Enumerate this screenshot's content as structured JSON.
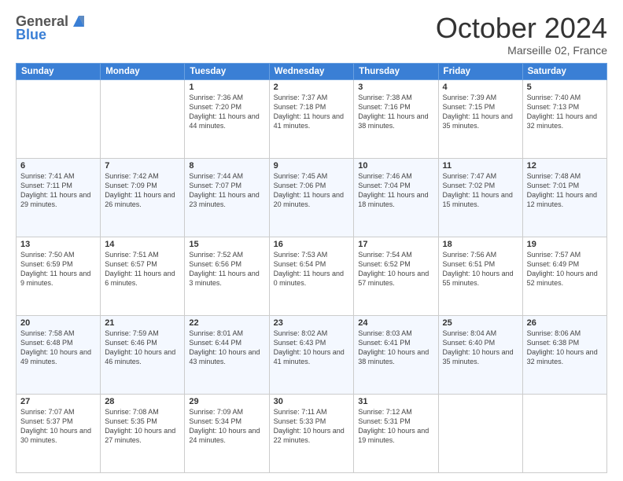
{
  "header": {
    "logo_line1": "General",
    "logo_line2": "Blue",
    "month": "October 2024",
    "location": "Marseille 02, France"
  },
  "days_of_week": [
    "Sunday",
    "Monday",
    "Tuesday",
    "Wednesday",
    "Thursday",
    "Friday",
    "Saturday"
  ],
  "weeks": [
    [
      {
        "day": "",
        "sunrise": "",
        "sunset": "",
        "daylight": ""
      },
      {
        "day": "",
        "sunrise": "",
        "sunset": "",
        "daylight": ""
      },
      {
        "day": "1",
        "sunrise": "Sunrise: 7:36 AM",
        "sunset": "Sunset: 7:20 PM",
        "daylight": "Daylight: 11 hours and 44 minutes."
      },
      {
        "day": "2",
        "sunrise": "Sunrise: 7:37 AM",
        "sunset": "Sunset: 7:18 PM",
        "daylight": "Daylight: 11 hours and 41 minutes."
      },
      {
        "day": "3",
        "sunrise": "Sunrise: 7:38 AM",
        "sunset": "Sunset: 7:16 PM",
        "daylight": "Daylight: 11 hours and 38 minutes."
      },
      {
        "day": "4",
        "sunrise": "Sunrise: 7:39 AM",
        "sunset": "Sunset: 7:15 PM",
        "daylight": "Daylight: 11 hours and 35 minutes."
      },
      {
        "day": "5",
        "sunrise": "Sunrise: 7:40 AM",
        "sunset": "Sunset: 7:13 PM",
        "daylight": "Daylight: 11 hours and 32 minutes."
      }
    ],
    [
      {
        "day": "6",
        "sunrise": "Sunrise: 7:41 AM",
        "sunset": "Sunset: 7:11 PM",
        "daylight": "Daylight: 11 hours and 29 minutes."
      },
      {
        "day": "7",
        "sunrise": "Sunrise: 7:42 AM",
        "sunset": "Sunset: 7:09 PM",
        "daylight": "Daylight: 11 hours and 26 minutes."
      },
      {
        "day": "8",
        "sunrise": "Sunrise: 7:44 AM",
        "sunset": "Sunset: 7:07 PM",
        "daylight": "Daylight: 11 hours and 23 minutes."
      },
      {
        "day": "9",
        "sunrise": "Sunrise: 7:45 AM",
        "sunset": "Sunset: 7:06 PM",
        "daylight": "Daylight: 11 hours and 20 minutes."
      },
      {
        "day": "10",
        "sunrise": "Sunrise: 7:46 AM",
        "sunset": "Sunset: 7:04 PM",
        "daylight": "Daylight: 11 hours and 18 minutes."
      },
      {
        "day": "11",
        "sunrise": "Sunrise: 7:47 AM",
        "sunset": "Sunset: 7:02 PM",
        "daylight": "Daylight: 11 hours and 15 minutes."
      },
      {
        "day": "12",
        "sunrise": "Sunrise: 7:48 AM",
        "sunset": "Sunset: 7:01 PM",
        "daylight": "Daylight: 11 hours and 12 minutes."
      }
    ],
    [
      {
        "day": "13",
        "sunrise": "Sunrise: 7:50 AM",
        "sunset": "Sunset: 6:59 PM",
        "daylight": "Daylight: 11 hours and 9 minutes."
      },
      {
        "day": "14",
        "sunrise": "Sunrise: 7:51 AM",
        "sunset": "Sunset: 6:57 PM",
        "daylight": "Daylight: 11 hours and 6 minutes."
      },
      {
        "day": "15",
        "sunrise": "Sunrise: 7:52 AM",
        "sunset": "Sunset: 6:56 PM",
        "daylight": "Daylight: 11 hours and 3 minutes."
      },
      {
        "day": "16",
        "sunrise": "Sunrise: 7:53 AM",
        "sunset": "Sunset: 6:54 PM",
        "daylight": "Daylight: 11 hours and 0 minutes."
      },
      {
        "day": "17",
        "sunrise": "Sunrise: 7:54 AM",
        "sunset": "Sunset: 6:52 PM",
        "daylight": "Daylight: 10 hours and 57 minutes."
      },
      {
        "day": "18",
        "sunrise": "Sunrise: 7:56 AM",
        "sunset": "Sunset: 6:51 PM",
        "daylight": "Daylight: 10 hours and 55 minutes."
      },
      {
        "day": "19",
        "sunrise": "Sunrise: 7:57 AM",
        "sunset": "Sunset: 6:49 PM",
        "daylight": "Daylight: 10 hours and 52 minutes."
      }
    ],
    [
      {
        "day": "20",
        "sunrise": "Sunrise: 7:58 AM",
        "sunset": "Sunset: 6:48 PM",
        "daylight": "Daylight: 10 hours and 49 minutes."
      },
      {
        "day": "21",
        "sunrise": "Sunrise: 7:59 AM",
        "sunset": "Sunset: 6:46 PM",
        "daylight": "Daylight: 10 hours and 46 minutes."
      },
      {
        "day": "22",
        "sunrise": "Sunrise: 8:01 AM",
        "sunset": "Sunset: 6:44 PM",
        "daylight": "Daylight: 10 hours and 43 minutes."
      },
      {
        "day": "23",
        "sunrise": "Sunrise: 8:02 AM",
        "sunset": "Sunset: 6:43 PM",
        "daylight": "Daylight: 10 hours and 41 minutes."
      },
      {
        "day": "24",
        "sunrise": "Sunrise: 8:03 AM",
        "sunset": "Sunset: 6:41 PM",
        "daylight": "Daylight: 10 hours and 38 minutes."
      },
      {
        "day": "25",
        "sunrise": "Sunrise: 8:04 AM",
        "sunset": "Sunset: 6:40 PM",
        "daylight": "Daylight: 10 hours and 35 minutes."
      },
      {
        "day": "26",
        "sunrise": "Sunrise: 8:06 AM",
        "sunset": "Sunset: 6:38 PM",
        "daylight": "Daylight: 10 hours and 32 minutes."
      }
    ],
    [
      {
        "day": "27",
        "sunrise": "Sunrise: 7:07 AM",
        "sunset": "Sunset: 5:37 PM",
        "daylight": "Daylight: 10 hours and 30 minutes."
      },
      {
        "day": "28",
        "sunrise": "Sunrise: 7:08 AM",
        "sunset": "Sunset: 5:35 PM",
        "daylight": "Daylight: 10 hours and 27 minutes."
      },
      {
        "day": "29",
        "sunrise": "Sunrise: 7:09 AM",
        "sunset": "Sunset: 5:34 PM",
        "daylight": "Daylight: 10 hours and 24 minutes."
      },
      {
        "day": "30",
        "sunrise": "Sunrise: 7:11 AM",
        "sunset": "Sunset: 5:33 PM",
        "daylight": "Daylight: 10 hours and 22 minutes."
      },
      {
        "day": "31",
        "sunrise": "Sunrise: 7:12 AM",
        "sunset": "Sunset: 5:31 PM",
        "daylight": "Daylight: 10 hours and 19 minutes."
      },
      {
        "day": "",
        "sunrise": "",
        "sunset": "",
        "daylight": ""
      },
      {
        "day": "",
        "sunrise": "",
        "sunset": "",
        "daylight": ""
      }
    ]
  ]
}
